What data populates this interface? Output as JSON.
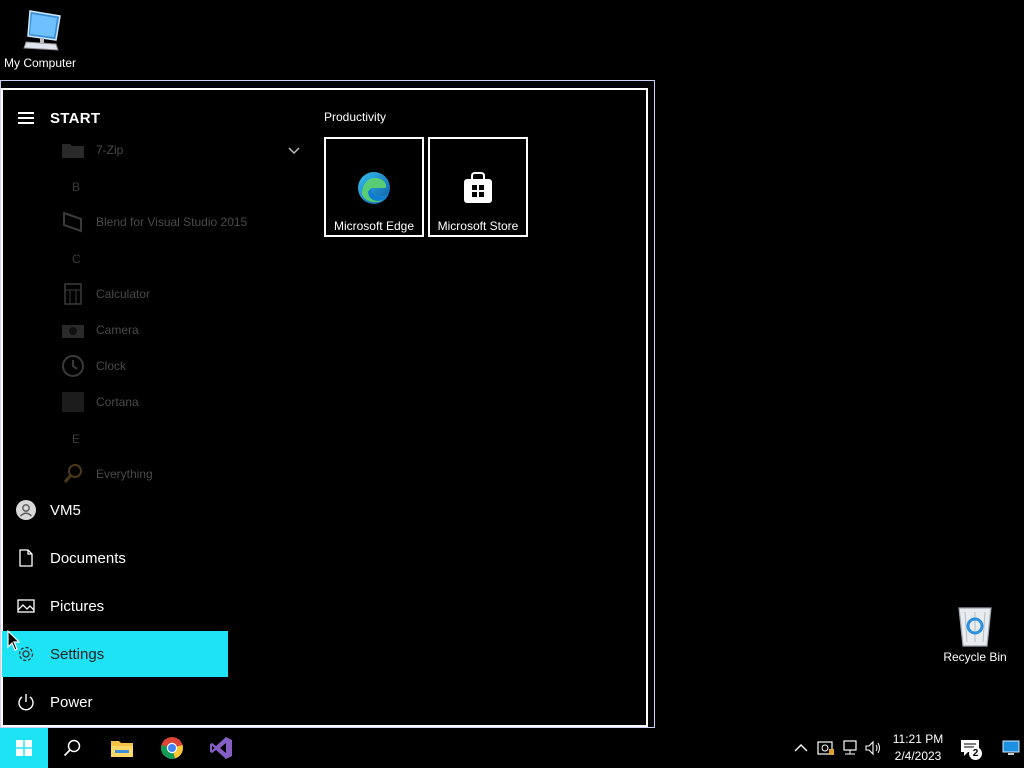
{
  "desktop": {
    "icons": [
      {
        "label": "My Computer",
        "icon": "computer-icon"
      },
      {
        "label": "Recycle Bin",
        "icon": "recycle-bin-icon"
      }
    ]
  },
  "start_menu": {
    "title": "START",
    "app_list": {
      "items": [
        {
          "label": "7-Zip",
          "icon": "folder-icon",
          "type": "folder"
        },
        {
          "label": "B",
          "type": "letter"
        },
        {
          "label": "Blend for Visual Studio 2015",
          "icon": "blend-icon",
          "type": "app"
        },
        {
          "label": "C",
          "type": "letter"
        },
        {
          "label": "Calculator",
          "icon": "calculator-icon",
          "type": "app"
        },
        {
          "label": "Camera",
          "icon": "camera-icon",
          "type": "app"
        },
        {
          "label": "Clock",
          "icon": "clock-icon",
          "type": "app"
        },
        {
          "label": "Cortana",
          "icon": "cortana-icon",
          "type": "app"
        },
        {
          "label": "E",
          "type": "letter"
        },
        {
          "label": "Everything",
          "icon": "search-icon",
          "type": "app"
        }
      ]
    },
    "nav": [
      {
        "label": "VM5",
        "icon": "user-avatar-icon",
        "active": false
      },
      {
        "label": "Documents",
        "icon": "document-icon",
        "active": false
      },
      {
        "label": "Pictures",
        "icon": "picture-icon",
        "active": false
      },
      {
        "label": "Settings",
        "icon": "gear-icon",
        "active": true
      },
      {
        "label": "Power",
        "icon": "power-icon",
        "active": false
      }
    ],
    "tile_group": {
      "title": "Productivity",
      "tiles": [
        {
          "label": "Microsoft Edge",
          "icon": "edge-icon"
        },
        {
          "label": "Microsoft Store",
          "icon": "store-icon"
        }
      ]
    }
  },
  "taskbar": {
    "pinned": [
      {
        "name": "start",
        "icon": "windows-icon"
      },
      {
        "name": "search",
        "icon": "search-icon"
      },
      {
        "name": "file-explorer",
        "icon": "folder-icon"
      },
      {
        "name": "chrome",
        "icon": "chrome-icon"
      },
      {
        "name": "visual-studio",
        "icon": "visual-studio-icon"
      }
    ],
    "tray": {
      "time": "11:21 PM",
      "date": "2/4/2023",
      "notification_count": "2"
    }
  },
  "colors": {
    "accent": "#1ee3f5",
    "background": "#000000",
    "text": "#ffffff"
  }
}
